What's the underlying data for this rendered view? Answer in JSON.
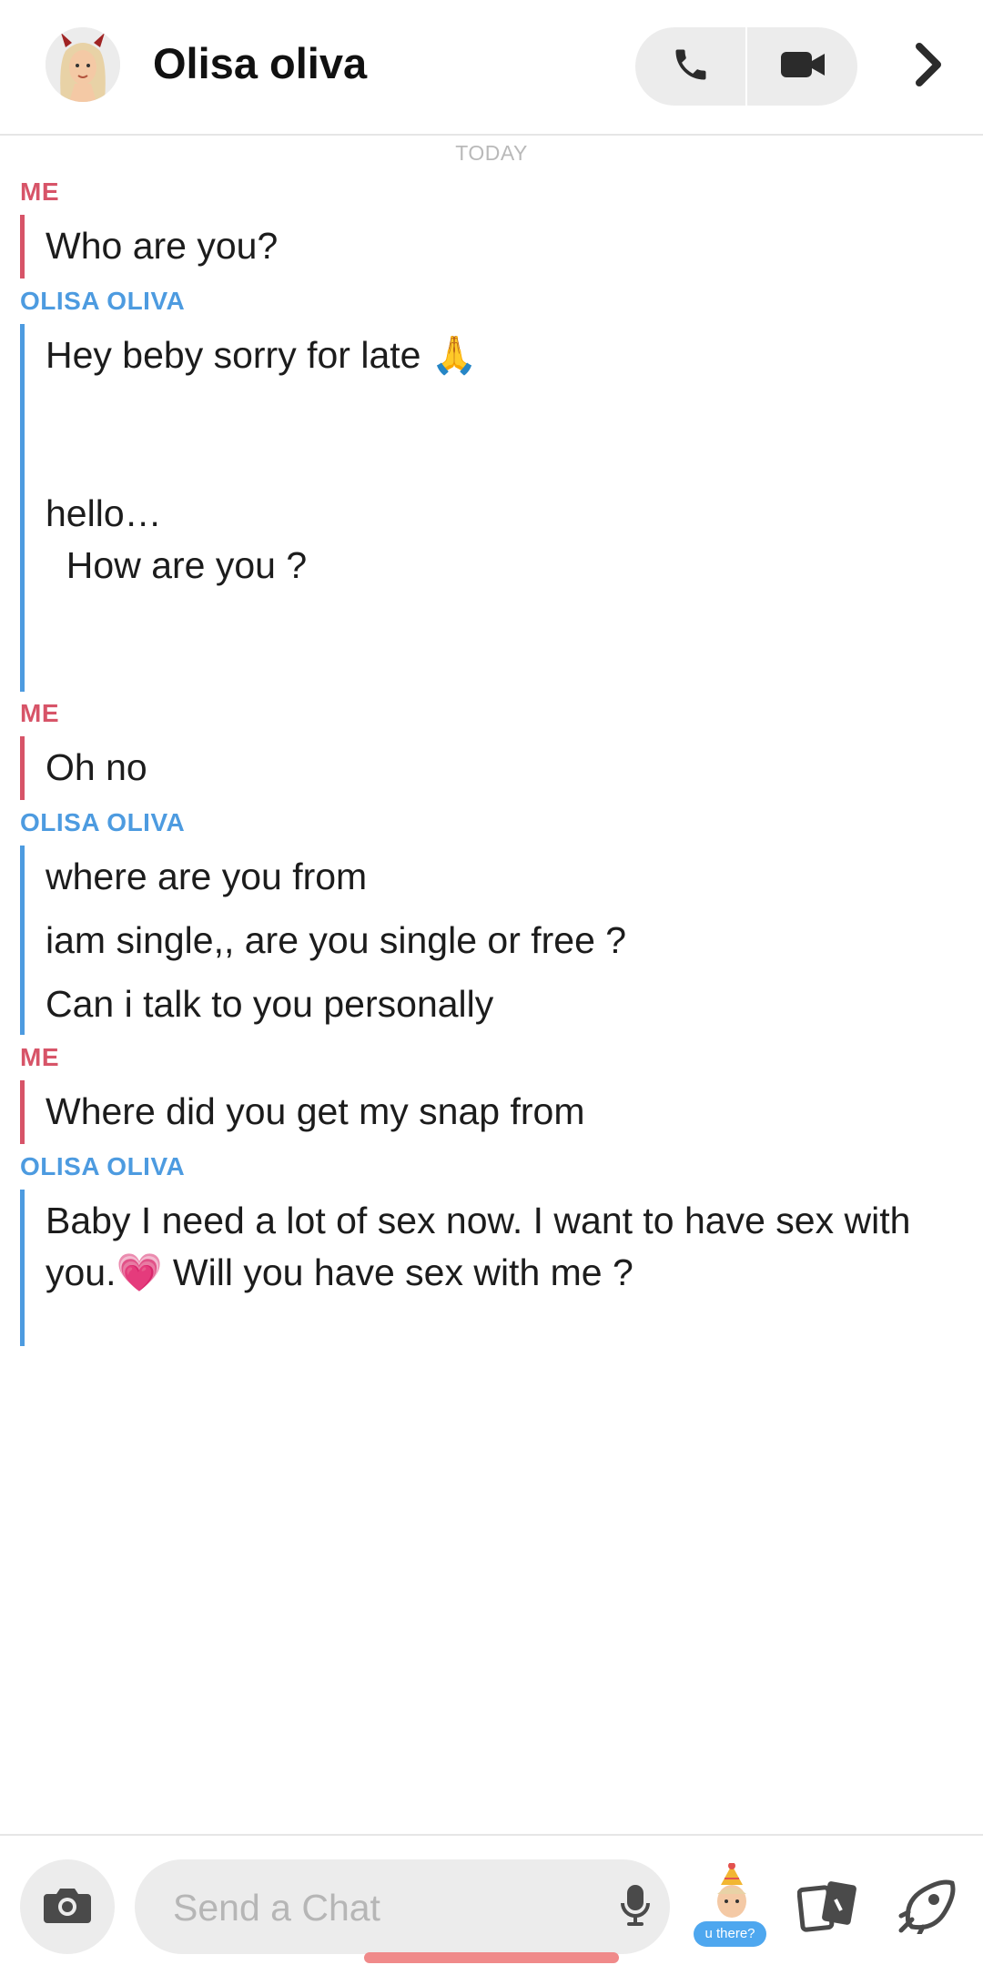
{
  "header": {
    "contact_name": "Olisa oliva",
    "avatar_icon": "bitmoji-avatar-icon",
    "phone_icon": "phone-icon",
    "video_icon": "video-camera-icon",
    "chevron_icon": "chevron-right-icon"
  },
  "conversation": {
    "date_label": "TODAY",
    "groups": [
      {
        "sender": "ME",
        "messages": [
          "Who are you?"
        ]
      },
      {
        "sender": "OLISA OLIVA",
        "messages": [
          "Hey beby sorry for late 🙏",
          "hello…\n  How are you ?"
        ]
      },
      {
        "sender": "ME",
        "messages": [
          "Oh no"
        ]
      },
      {
        "sender": "OLISA OLIVA",
        "messages": [
          "where are you from",
          "iam single,, are you single or free ?",
          "Can i talk to you personally"
        ]
      },
      {
        "sender": "ME",
        "messages": [
          "Where did you get my snap from"
        ]
      },
      {
        "sender": "OLISA OLIVA",
        "messages": [
          "Baby I need a lot of sex now. I want to have sex with\nyou.💗 Will you have sex with me ?"
        ]
      }
    ]
  },
  "composer": {
    "placeholder": "Send a Chat",
    "bitmoji_caption": "u there?",
    "camera_icon": "camera-icon",
    "mic_icon": "microphone-icon",
    "cards_icon": "cards-icon",
    "games_icon": "games-rocket-icon"
  },
  "colors": {
    "me": "#d75468",
    "them": "#4d9be0"
  }
}
